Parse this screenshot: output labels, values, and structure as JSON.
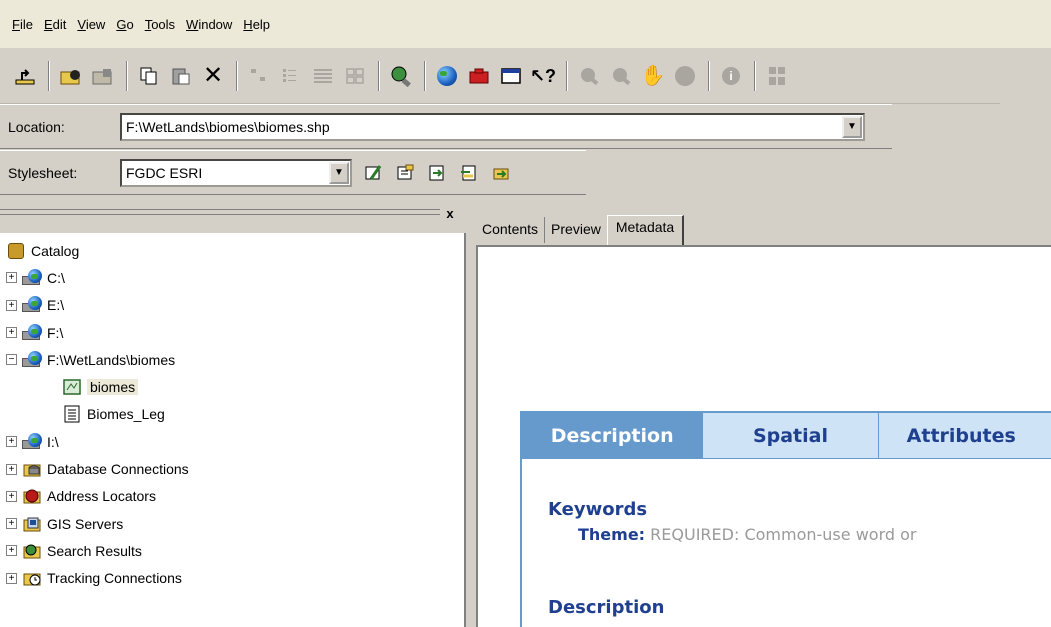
{
  "menu": {
    "items": [
      {
        "accel": "F",
        "rest": "ile"
      },
      {
        "accel": "E",
        "rest": "dit"
      },
      {
        "accel": "V",
        "rest": "iew"
      },
      {
        "accel": "G",
        "rest": "o"
      },
      {
        "accel": "T",
        "rest": "ools"
      },
      {
        "accel": "W",
        "rest": "indow"
      },
      {
        "accel": "H",
        "rest": "elp"
      }
    ]
  },
  "toolbar": {
    "icons": [
      "up-one-level-icon",
      "connect-folder-icon",
      "disconnect-folder-icon",
      "copy-icon",
      "paste-icon",
      "delete-icon",
      "large-icons-icon",
      "list-icon",
      "details-icon",
      "thumbnails-icon",
      "search-icon",
      "launch-arcmap-icon",
      "arctoolbox-icon",
      "command-line-icon",
      "whats-this-icon",
      "zoom-in-icon",
      "zoom-out-icon",
      "pan-icon",
      "full-extent-icon",
      "identify-icon",
      "create-thumbnail-icon"
    ]
  },
  "location": {
    "label": "Location:",
    "value": "F:\\WetLands\\biomes\\biomes.shp"
  },
  "stylesheet": {
    "label": "Stylesheet:",
    "value": "FGDC ESRI"
  },
  "catalog": {
    "close_glyph": "x",
    "items": [
      {
        "label": "Catalog"
      },
      {
        "label": "C:\\"
      },
      {
        "label": "E:\\"
      },
      {
        "label": "F:\\"
      },
      {
        "label": "F:\\WetLands\\biomes"
      },
      {
        "label": "biomes"
      },
      {
        "label": "Biomes_Leg"
      },
      {
        "label": "I:\\"
      },
      {
        "label": "Database Connections"
      },
      {
        "label": "Address Locators"
      },
      {
        "label": "GIS Servers"
      },
      {
        "label": "Search Results"
      },
      {
        "label": "Tracking Connections"
      }
    ]
  },
  "tabs": {
    "contents": "Contents",
    "preview": "Preview",
    "metadata": "Metadata"
  },
  "metadata": {
    "tabs": [
      "Description",
      "Spatial",
      "Attributes"
    ],
    "keywords_heading": "Keywords",
    "theme_key": "Theme:",
    "theme_value": "REQUIRED: Common-use word or",
    "description_heading": "Description"
  },
  "colors": {
    "window_bg": "#d4d0c8",
    "menu_bg": "#ece9d8",
    "metadata_accent": "#6699cc",
    "metadata_heading": "#1f3f8f"
  }
}
